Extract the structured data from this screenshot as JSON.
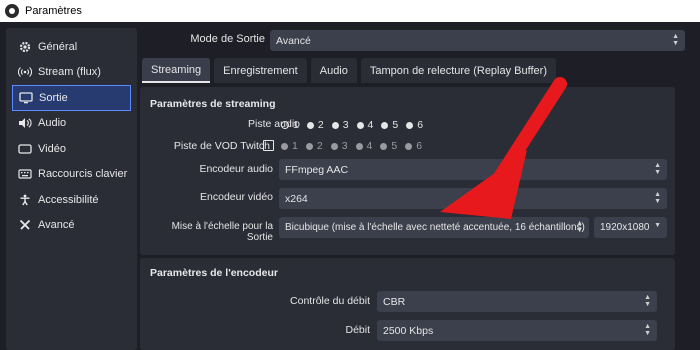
{
  "window": {
    "title": "Paramètres"
  },
  "sidebar": {
    "items": [
      {
        "label": "Général",
        "icon": "gear-icon"
      },
      {
        "label": "Stream (flux)",
        "icon": "broadcast-icon"
      },
      {
        "label": "Sortie",
        "icon": "monitor-icon"
      },
      {
        "label": "Audio",
        "icon": "speaker-icon"
      },
      {
        "label": "Vidéo",
        "icon": "video-icon"
      },
      {
        "label": "Raccourcis clavier",
        "icon": "keyboard-icon"
      },
      {
        "label": "Accessibilité",
        "icon": "accessibility-icon"
      },
      {
        "label": "Avancé",
        "icon": "tools-icon"
      }
    ],
    "active": "Sortie"
  },
  "output_mode": {
    "label": "Mode de Sortie",
    "value": "Avancé"
  },
  "tabs": [
    {
      "label": "Streaming"
    },
    {
      "label": "Enregistrement"
    },
    {
      "label": "Audio"
    },
    {
      "label": "Tampon de relecture (Replay Buffer)"
    }
  ],
  "streaming": {
    "title": "Paramètres de streaming",
    "audio_track": {
      "label": "Piste audio",
      "options": [
        "1",
        "2",
        "3",
        "4",
        "5",
        "6"
      ],
      "selected": "1"
    },
    "twitch_vod": {
      "label": "Piste de VOD Twitch",
      "options": [
        "1",
        "2",
        "3",
        "4",
        "5",
        "6"
      ]
    },
    "audio_encoder": {
      "label": "Encodeur audio",
      "value": "FFmpeg AAC"
    },
    "video_encoder": {
      "label": "Encodeur vidéo",
      "value": "x264"
    },
    "rescale": {
      "label": "Mise à l'échelle pour la Sortie",
      "filter": "Bicubique (mise à l'échelle avec netteté accentuée, 16 échantillons)",
      "resolution": "1920x1080"
    }
  },
  "encoder": {
    "title": "Paramètres de l'encodeur",
    "rate_control": {
      "label": "Contrôle du débit",
      "value": "CBR"
    },
    "bitrate": {
      "label": "Débit",
      "value": "2500 Kbps"
    }
  },
  "colors": {
    "accent": "#5a8cff",
    "arrow": "#e8191c",
    "background": "#1e1f26",
    "panel": "#2a2c36"
  }
}
